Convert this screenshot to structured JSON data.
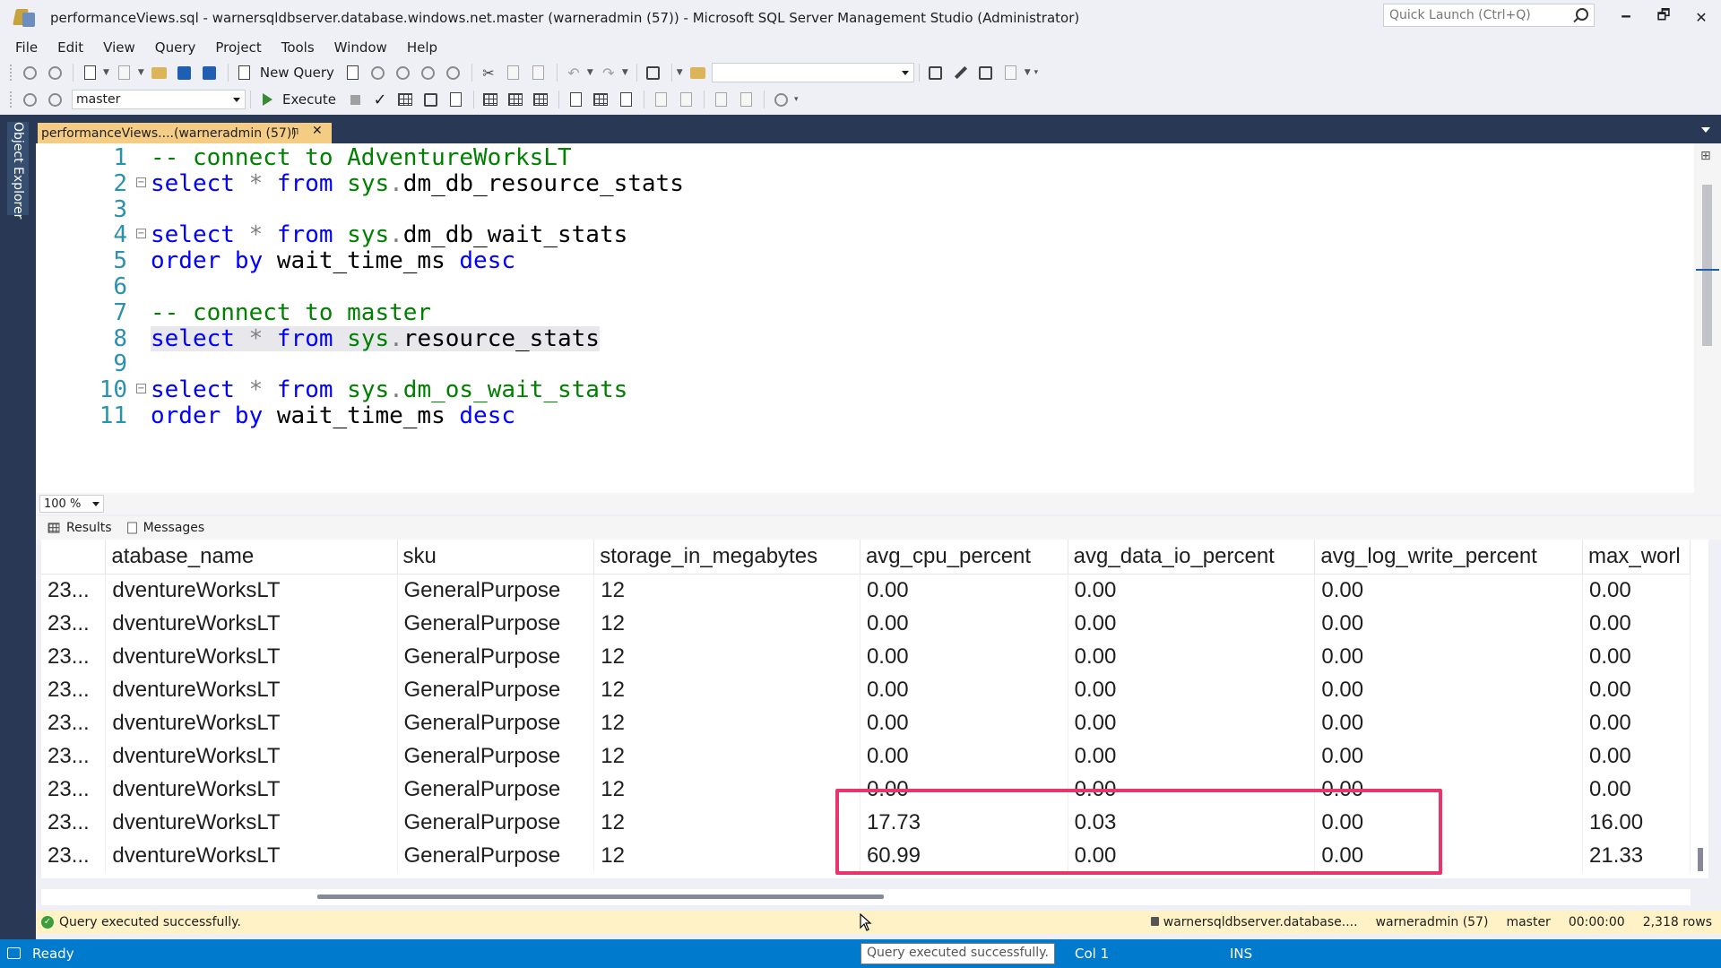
{
  "window": {
    "title": "performanceViews.sql - warnersqldbserver.database.windows.net.master (warneradmin (57)) - Microsoft SQL Server Management Studio (Administrator)",
    "quick_launch_placeholder": "Quick Launch (Ctrl+Q)",
    "minimize": "🗕",
    "restore": "🗗",
    "close": "✕"
  },
  "menu": [
    "File",
    "Edit",
    "View",
    "Query",
    "Project",
    "Tools",
    "Window",
    "Help"
  ],
  "toolbar": {
    "new_query_label": "New Query",
    "database_selected": "master",
    "execute_label": "Execute",
    "check_glyph": "✓"
  },
  "object_explorer_label": "Object Explorer",
  "doc_tab": {
    "title": "performanceViews....(warneradmin (57))",
    "pin_glyph": "⊓",
    "close_glyph": "✕"
  },
  "editor": {
    "lines": [
      {
        "n": "1",
        "tokens": [
          {
            "t": "-- connect to AdventureWorksLT",
            "k": "comment"
          }
        ]
      },
      {
        "n": "2",
        "fold": "⊟",
        "tokens": [
          {
            "t": "select",
            "k": "keyword"
          },
          {
            "t": " ",
            "k": "plain"
          },
          {
            "t": "*",
            "k": "op"
          },
          {
            "t": " ",
            "k": "plain"
          },
          {
            "t": "from",
            "k": "keyword"
          },
          {
            "t": " ",
            "k": "plain"
          },
          {
            "t": "sys",
            "k": "sys"
          },
          {
            "t": ".",
            "k": "op"
          },
          {
            "t": "dm_db_resource_stats",
            "k": "ident"
          }
        ]
      },
      {
        "n": "3",
        "tokens": []
      },
      {
        "n": "4",
        "fold": "⊟",
        "tokens": [
          {
            "t": "select",
            "k": "keyword"
          },
          {
            "t": " ",
            "k": "plain"
          },
          {
            "t": "*",
            "k": "op"
          },
          {
            "t": " ",
            "k": "plain"
          },
          {
            "t": "from",
            "k": "keyword"
          },
          {
            "t": " ",
            "k": "plain"
          },
          {
            "t": "sys",
            "k": "sys"
          },
          {
            "t": ".",
            "k": "op"
          },
          {
            "t": "dm_db_wait_stats",
            "k": "ident"
          }
        ]
      },
      {
        "n": "5",
        "tokens": [
          {
            "t": "order by",
            "k": "keyword"
          },
          {
            "t": " wait_time_ms ",
            "k": "ident"
          },
          {
            "t": "desc",
            "k": "keyword"
          }
        ]
      },
      {
        "n": "6",
        "tokens": []
      },
      {
        "n": "7",
        "tokens": [
          {
            "t": "-- connect to master",
            "k": "comment"
          }
        ]
      },
      {
        "n": "8",
        "highlight": true,
        "tokens": [
          {
            "t": "select",
            "k": "keyword"
          },
          {
            "t": " ",
            "k": "plain"
          },
          {
            "t": "*",
            "k": "op"
          },
          {
            "t": " ",
            "k": "plain"
          },
          {
            "t": "from",
            "k": "keyword"
          },
          {
            "t": " ",
            "k": "plain"
          },
          {
            "t": "sys",
            "k": "sys"
          },
          {
            "t": ".",
            "k": "op"
          },
          {
            "t": "resource_stats",
            "k": "ident"
          }
        ]
      },
      {
        "n": "9",
        "tokens": []
      },
      {
        "n": "10",
        "fold": "⊟",
        "tokens": [
          {
            "t": "select",
            "k": "keyword"
          },
          {
            "t": " ",
            "k": "plain"
          },
          {
            "t": "*",
            "k": "op"
          },
          {
            "t": " ",
            "k": "plain"
          },
          {
            "t": "from",
            "k": "keyword"
          },
          {
            "t": " ",
            "k": "plain"
          },
          {
            "t": "sys",
            "k": "sys"
          },
          {
            "t": ".",
            "k": "op"
          },
          {
            "t": "dm_os_wait_stats",
            "k": "fn"
          }
        ]
      },
      {
        "n": "11",
        "tokens": [
          {
            "t": "order by",
            "k": "keyword"
          },
          {
            "t": " wait_time_ms ",
            "k": "ident"
          },
          {
            "t": "desc",
            "k": "keyword"
          }
        ]
      }
    ],
    "zoom": "100 %"
  },
  "results": {
    "tabs": [
      "Results",
      "Messages"
    ],
    "columns": [
      "",
      "atabase_name",
      "sku",
      "storage_in_megabytes",
      "avg_cpu_percent",
      "avg_data_io_percent",
      "avg_log_write_percent",
      "max_worl"
    ],
    "rows": [
      [
        "23...",
        "dventureWorksLT",
        "GeneralPurpose",
        "12",
        "0.00",
        "0.00",
        "0.00",
        "0.00"
      ],
      [
        "23...",
        "dventureWorksLT",
        "GeneralPurpose",
        "12",
        "0.00",
        "0.00",
        "0.00",
        "0.00"
      ],
      [
        "23...",
        "dventureWorksLT",
        "GeneralPurpose",
        "12",
        "0.00",
        "0.00",
        "0.00",
        "0.00"
      ],
      [
        "23...",
        "dventureWorksLT",
        "GeneralPurpose",
        "12",
        "0.00",
        "0.00",
        "0.00",
        "0.00"
      ],
      [
        "23...",
        "dventureWorksLT",
        "GeneralPurpose",
        "12",
        "0.00",
        "0.00",
        "0.00",
        "0.00"
      ],
      [
        "23...",
        "dventureWorksLT",
        "GeneralPurpose",
        "12",
        "0.00",
        "0.00",
        "0.00",
        "0.00"
      ],
      [
        "23...",
        "dventureWorksLT",
        "GeneralPurpose",
        "12",
        "0.00",
        "0.00",
        "0.00",
        "0.00"
      ],
      [
        "23...",
        "dventureWorksLT",
        "GeneralPurpose",
        "12",
        "17.73",
        "0.03",
        "0.00",
        "16.00"
      ],
      [
        "23...",
        "dventureWorksLT",
        "GeneralPurpose",
        "12",
        "60.99",
        "0.00",
        "0.00",
        "21.33"
      ]
    ],
    "highlight_color": "#e8356e"
  },
  "query_status": {
    "message": "Query executed successfully.",
    "server": "warnersqldbserver.database....",
    "user": "warneradmin (57)",
    "database": "master",
    "elapsed": "00:00:00",
    "rows": "2,318 rows"
  },
  "app_status": {
    "ready": "Ready",
    "tooltip": "Query executed successfully.",
    "col": "Col 1",
    "ins": "INS"
  },
  "colors": {
    "frame": "#293955",
    "tab_active": "#f5cc84",
    "status_bar": "#007acc",
    "query_status_bg": "#fff2c7"
  }
}
